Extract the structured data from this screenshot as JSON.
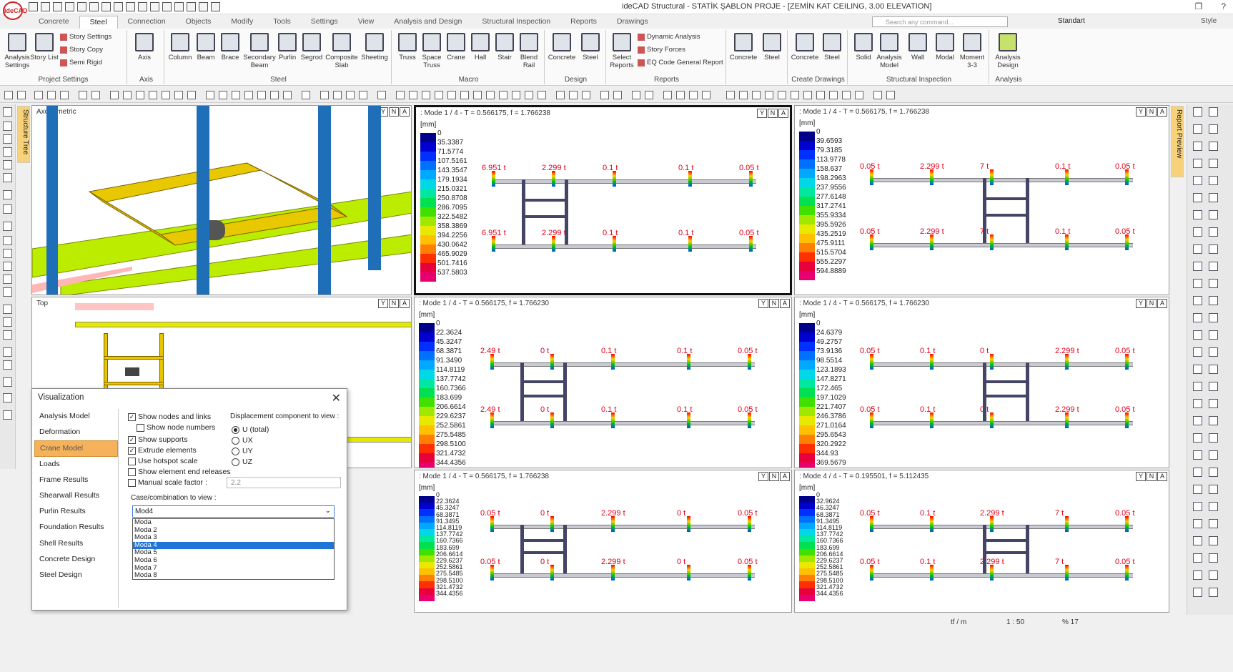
{
  "window": {
    "title": "ideCAD Structural - STATİK ŞABLON PROJE - [ZEMİN KAT CEILING, 3.00 ELEVATION]",
    "logo": "ideCAD"
  },
  "menu_tabs": [
    "Concrete",
    "Steel",
    "Connection",
    "Objects",
    "Modify",
    "Tools",
    "Settings",
    "View",
    "Analysis and Design",
    "Structural Inspection",
    "Reports",
    "Drawings"
  ],
  "search_placeholder": "Search any command...",
  "standard_label": "Standart",
  "style_label": "Style",
  "ribbon": {
    "groups": [
      "Project Settings",
      "Axis",
      "Steel",
      "Macro",
      "Design",
      "Reports",
      "Create Drawings",
      "Structural Inspection",
      "Analysis"
    ],
    "analysis_settings": "Analysis Settings",
    "story_list": "Story List",
    "story_settings": "Story Settings",
    "story_copy": "Story Copy",
    "semi_rigid": "Semi Rigid",
    "axis": "Axis",
    "steel_tools": [
      "Column",
      "Beam",
      "Brace",
      "Secondary Beam",
      "Purlin",
      "Segrod",
      "Composite Slab",
      "Sheeting"
    ],
    "macro_tools": [
      "Truss",
      "Space Truss",
      "Crane",
      "Hall",
      "Stair",
      "Blend Rail"
    ],
    "design_tools": [
      "Concrete",
      "Steel"
    ],
    "select_reports": "Select Reports",
    "dynamic_analysis": "Dynamic Analysis",
    "story_forces": "Story Forces",
    "eq_code": "EQ Code General Report",
    "create_drawings": [
      "Concrete",
      "Steel"
    ],
    "cd_tools": [
      "Concrete",
      "Steel"
    ],
    "inspection_tools": [
      "Solid",
      "Analysis Model",
      "Wall",
      "Modal",
      "Moment 3-3"
    ],
    "analysis_design": "Analysis Design"
  },
  "left_panel": {
    "structure_tree": "Structure Tree"
  },
  "right_panel": {
    "report_preview": "Report Preview"
  },
  "viewports": {
    "v1": {
      "title": "Axonometric"
    },
    "v2": {
      "title": "Top"
    },
    "p1": {
      "title": ": Mode 1 / 4 - T = 0.566175, f = 1.766238",
      "unit": "[mm]",
      "legend": [
        "0",
        "35.3387",
        "71.5774",
        "107.5161",
        "143.3547",
        "179.1934",
        "215.0321",
        "250.8708",
        "286.7095",
        "322.5482",
        "358.3869",
        "394.2256",
        "430.0642",
        "465.9029",
        "501.7416",
        "537.5803"
      ],
      "forces_top": [
        "6.951 t",
        "2.299 t",
        "0.1 t",
        "0.1 t",
        "0.05 t"
      ],
      "forces_bot": [
        "6.951 t",
        "2.299 t",
        "0.1 t",
        "0.1 t",
        "0.05 t"
      ]
    },
    "p2": {
      "title": ": Mode 1 / 4 - T = 0.566175, f = 1.766238",
      "unit": "[mm]",
      "legend": [
        "0",
        "39.6593",
        "79.3185",
        "113.9778",
        "158.637",
        "198.2963",
        "237.9556",
        "277.6148",
        "317.2741",
        "355.9334",
        "395.5926",
        "435.2519",
        "475.9111",
        "515.5704",
        "555.2297",
        "594.8889"
      ],
      "forces_top": [
        "0.05 t",
        "2.299 t",
        "7 t",
        "0.1 t",
        "0.05 t"
      ],
      "forces_bot": [
        "0.05 t",
        "2.299 t",
        "7 t",
        "0.1 t",
        "0.05 t"
      ]
    },
    "p3": {
      "title": ": Mode 1 / 4 - T = 0.566175, f = 1.766230",
      "unit": "[mm]",
      "legend": [
        "0",
        "22.3624",
        "45.3247",
        "68.3871",
        "91.3490",
        "114.8119",
        "137.7742",
        "160.7366",
        "183.699",
        "206.6614",
        "229.6237",
        "252.5861",
        "275.5485",
        "298.5100",
        "321.4732",
        "344.4356"
      ],
      "forces_top": [
        "2.49 t",
        "0 t",
        "0.1 t",
        "0.1 t",
        "0.05 t"
      ],
      "forces_bot": [
        "2.49 t",
        "0 t",
        "0.1 t",
        "0.1 t",
        "0.05 t"
      ]
    },
    "p4": {
      "title": ": Mode 1 / 4 - T = 0.566175, f = 1.766230",
      "unit": "[mm]",
      "legend": [
        "0",
        "24.6379",
        "49.2757",
        "73.9136",
        "98.5514",
        "123.1893",
        "147.8271",
        "172.465",
        "197.1029",
        "221.7407",
        "246.3786",
        "271.0164",
        "295.6543",
        "320.2922",
        "344.93",
        "369.5679"
      ],
      "forces_top": [
        "0.05 t",
        "0.1 t",
        "0 t",
        "2.299 t",
        "0.05 t"
      ],
      "forces_bot": [
        "0.05 t",
        "0.1 t",
        "0 t",
        "2.299 t",
        "0.05 t"
      ]
    },
    "p5": {
      "title": ": Mode 1 / 4 - T = 0.566175, f = 1.766238",
      "unit": "[mm]",
      "legend": [
        "0",
        "22.3624",
        "45.3247",
        "68.3871",
        "91.3495",
        "114.8119",
        "137.7742",
        "160.7366",
        "183.699",
        "206.6614",
        "229.6237",
        "252.5861",
        "275.5485",
        "298.5100",
        "321.4732",
        "344.4356"
      ],
      "forces_top": [
        "0.05 t",
        "0 t",
        "2.299 t",
        "0 t",
        "0.05 t"
      ],
      "forces_bot": [
        "0.05 t",
        "0 t",
        "2.299 t",
        "0 t",
        "0.05 t"
      ]
    },
    "p6": {
      "title": ": Mode 4 / 4 - T = 0.195501, f = 5.112435",
      "unit": "[mm]",
      "legend": [
        "0",
        "32.9624",
        "46.3247",
        "68.3871",
        "91.3495",
        "114.8119",
        "137.7742",
        "160.7366",
        "183.699",
        "206.6614",
        "229.6237",
        "252.5861",
        "275.5485",
        "298.5100",
        "321.4732",
        "344.4356"
      ],
      "forces_top": [
        "0.05 t",
        "0.1 t",
        "2.299 t",
        "7 t",
        "0.05 t"
      ],
      "forces_bot": [
        "0.05 t",
        "0.1 t",
        "2.299 t",
        "7 t",
        "0.05 t"
      ]
    }
  },
  "yn": [
    "Y",
    "N",
    "A"
  ],
  "dialog": {
    "title": "Visualization",
    "nav": [
      "Analysis Model",
      "Deformation",
      "Crane Model",
      "Loads",
      "Frame Results",
      "Shearwall Results",
      "Purlin Results",
      "Foundation Results",
      "Shell Results",
      "Concrete Design",
      "Steel Design"
    ],
    "show_nodes": "Show nodes and links",
    "show_node_numbers": "Show node numbers",
    "show_supports": "Show supports",
    "extrude": "Extrude elements",
    "hotspot": "Use hotspot scale",
    "show_releases": "Show element end releases",
    "manual_scale": "Manual scale factor :",
    "scale_value": "2.2",
    "disp_label": "Displacement component to view :",
    "radios": [
      "U (total)",
      "UX",
      "UY",
      "UZ"
    ],
    "case_label": "Case/combination to view :",
    "selected": "Mod4",
    "options": [
      "Moda",
      "Moda 2",
      "Moda 3",
      "Moda 4",
      "Moda 5",
      "Moda 6",
      "Moda 7",
      "Moda 8"
    ]
  },
  "status": {
    "unit": "tf / m",
    "scale": "1 : 50",
    "zoom": "% 17"
  }
}
